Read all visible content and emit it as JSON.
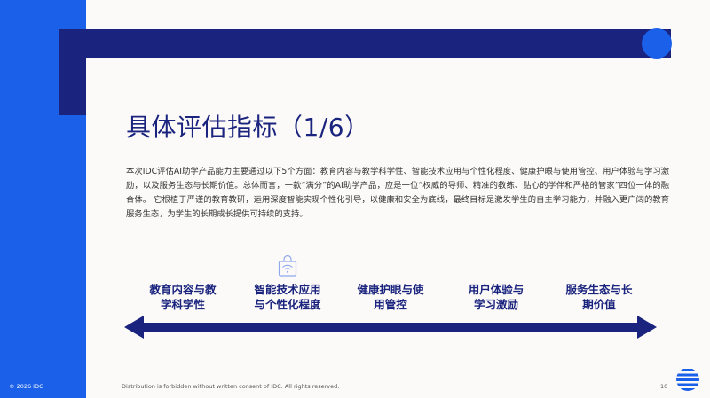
{
  "slide": {
    "title": "具体评估指标（1/6）",
    "intro": "本次IDC评估AI助学产品能力主要通过以下5个方面：教育内容与教学科学性、智能技术应用与个性化程度、健康护眼与使用管控、用户体验与学习激励，以及服务生态与长期价值。总体而言，一款“满分”的AI助学产品，应是一位“权威的导师、精准的教练、贴心的学伴和严格的管家”四位一体的融合体。 它根植于严谨的教育教研，运用深度智能实现个性化引导，以健康和安全为底线，最终目标是激发学生的自主学习能力，并融入更广阔的教育服务生态，为学生的长期成长提供可持续的支持。",
    "categories": [
      {
        "line1": "教育内容与教",
        "line2": "学科学性"
      },
      {
        "line1": "智能技术应用",
        "line2": "与个性化程度"
      },
      {
        "line1": "健康护眼与使",
        "line2": "用管控"
      },
      {
        "line1": "用户体验与",
        "line2": "学习激励"
      },
      {
        "line1": "服务生态与长",
        "line2": "期价值"
      }
    ]
  },
  "footer": {
    "copyright": "© 2026 IDC",
    "disclaimer": "Distribution is forbidden without written consent of IDC. All rights reserved.",
    "page_number": "10"
  },
  "icons": {
    "category_icon": "wifi-bag-icon",
    "logo": "idc-globe-icon"
  },
  "colors": {
    "navy": "#1a237e",
    "blue": "#1a60e8",
    "background": "#fcfaf8"
  }
}
